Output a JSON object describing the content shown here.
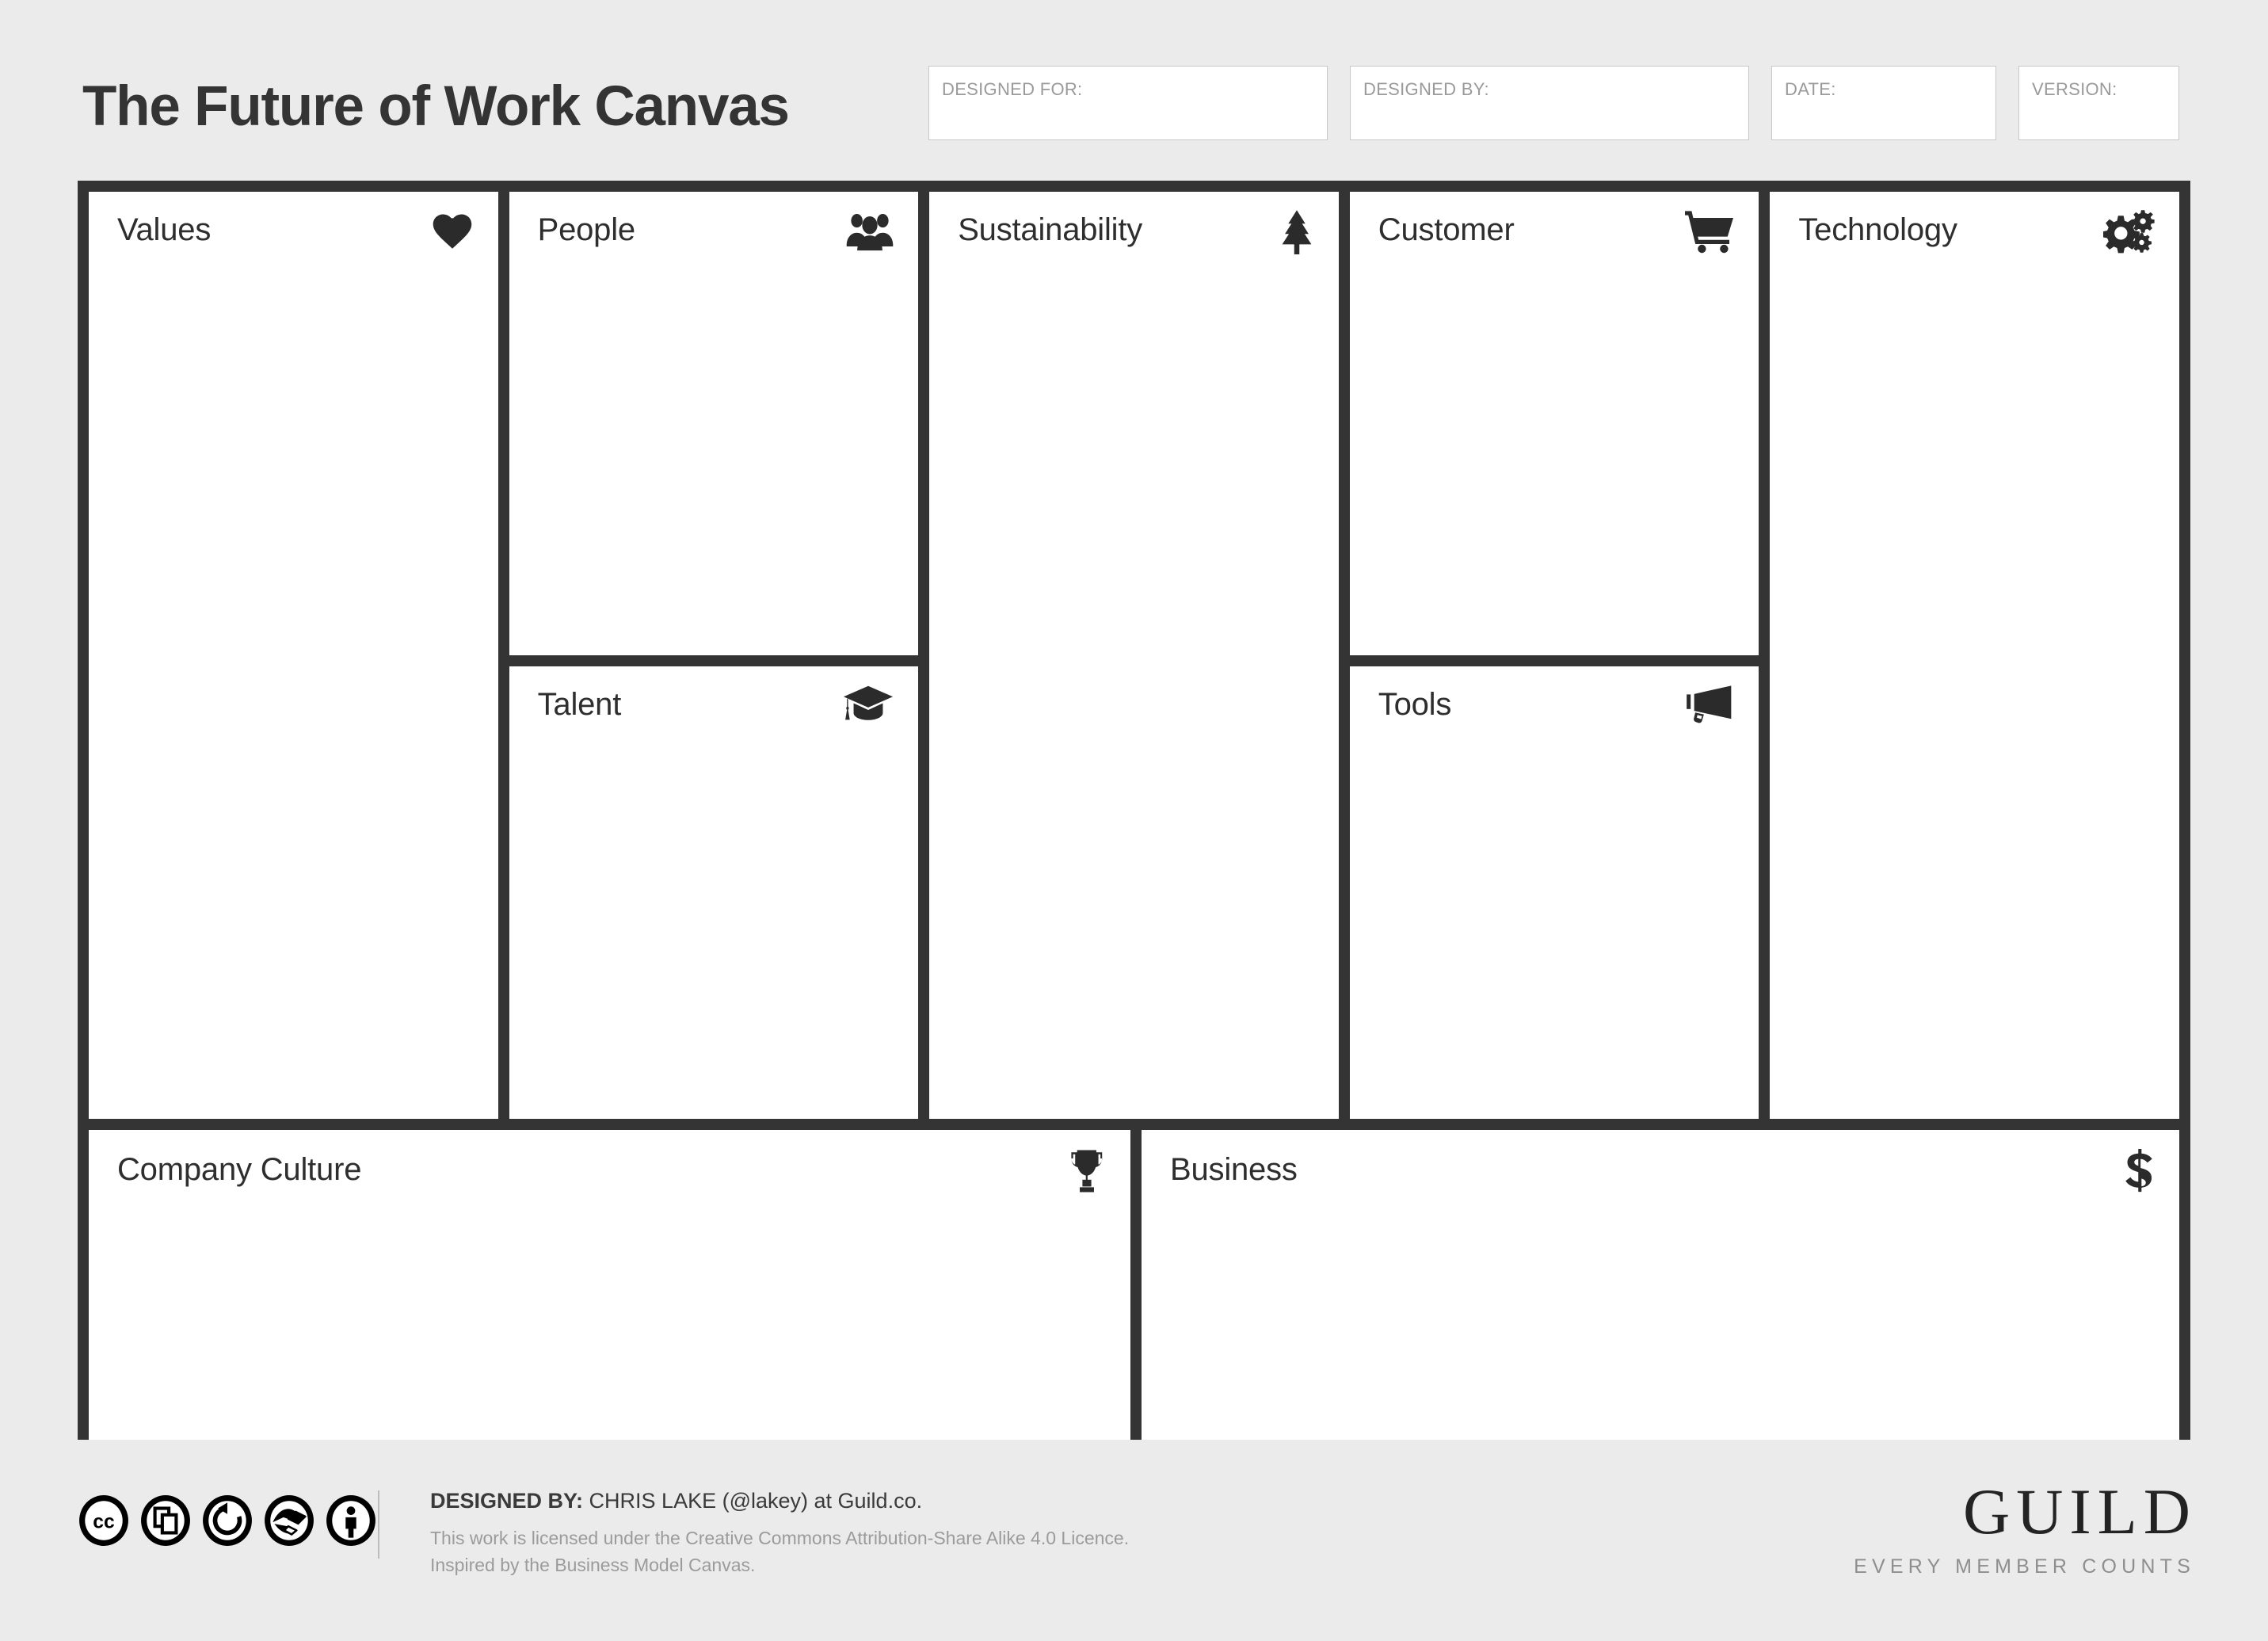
{
  "header": {
    "title": "The Future of Work Canvas",
    "fields": [
      {
        "label": "DESIGNED FOR:",
        "value": "",
        "size": "wide"
      },
      {
        "label": "DESIGNED BY:",
        "value": "",
        "size": "wide"
      },
      {
        "label": "DATE:",
        "value": "",
        "size": "medium"
      },
      {
        "label": "VERSION:",
        "value": "",
        "size": "small"
      }
    ]
  },
  "canvas": {
    "sections": [
      {
        "title": "Values",
        "icon": "heart-icon",
        "content": ""
      },
      {
        "title": "People",
        "icon": "users-group-icon",
        "content": ""
      },
      {
        "title": "Talent",
        "icon": "graduation-cap-icon",
        "content": ""
      },
      {
        "title": "Sustainability",
        "icon": "tree-icon",
        "content": ""
      },
      {
        "title": "Customer",
        "icon": "shopping-cart-icon",
        "content": ""
      },
      {
        "title": "Tools",
        "icon": "megaphone-icon",
        "content": ""
      },
      {
        "title": "Technology",
        "icon": "gears-icon",
        "content": ""
      },
      {
        "title": "Company Culture",
        "icon": "trophy-icon",
        "content": ""
      },
      {
        "title": "Business",
        "icon": "dollar-sign-icon",
        "content": ""
      }
    ]
  },
  "footer": {
    "license_badges": [
      "creative-commons-icon",
      "share-copy-icon",
      "share-alike-icon",
      "remix-icon",
      "attribution-icon"
    ],
    "designed_by_label": "DESIGNED BY:",
    "designed_by_value": "CHRIS LAKE (@lakey) at Guild.co.",
    "license_line": "This work is licensed under the Creative Commons Attribution-Share Alike 4.0 Licence.",
    "inspired_line": "Inspired by the Business Model Canvas.",
    "brand_name": "GUILD",
    "brand_tagline": "EVERY MEMBER COUNTS"
  },
  "colors": {
    "background": "#ebebeb",
    "frame": "#343434",
    "cell": "#ffffff",
    "text": "#2e2e2e",
    "muted": "#9a9a9a"
  }
}
